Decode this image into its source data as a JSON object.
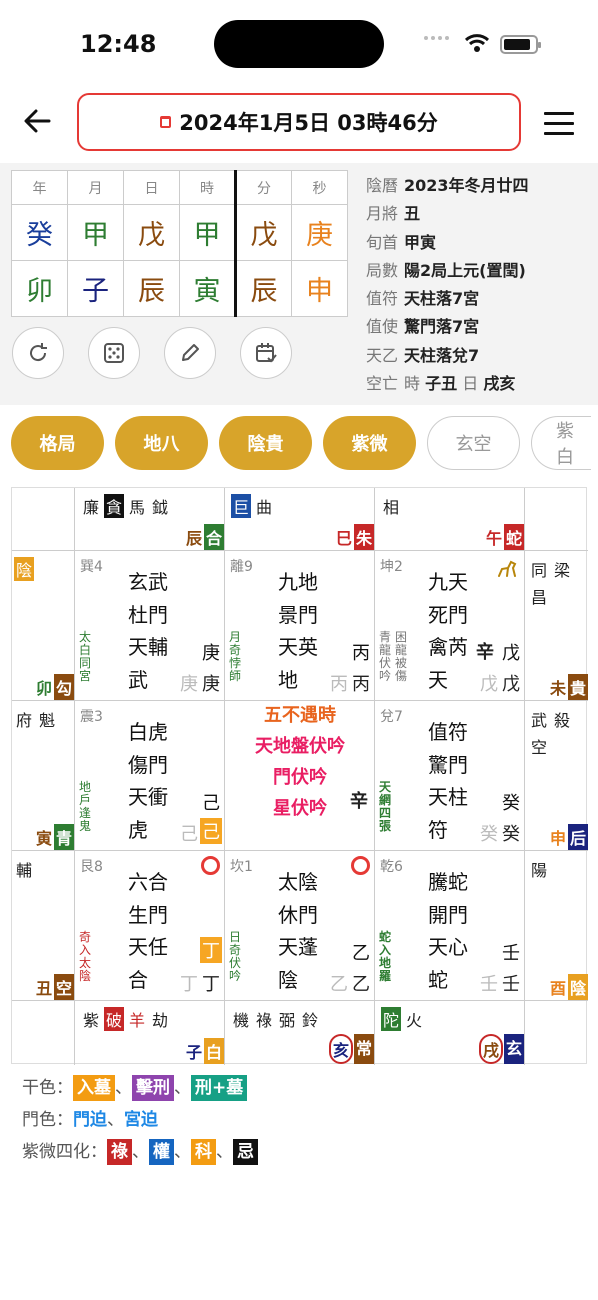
{
  "status": {
    "time": "12:48"
  },
  "header": {
    "date": "2024年1月5日 03時46分"
  },
  "pillars": {
    "headers": [
      "年",
      "月",
      "日",
      "時",
      "分",
      "秒"
    ],
    "stems": [
      "癸",
      "甲",
      "戊",
      "甲",
      "戊",
      "庚"
    ],
    "branches": [
      "卯",
      "子",
      "辰",
      "寅",
      "辰",
      "申"
    ]
  },
  "info": [
    {
      "label": "陰曆",
      "value": "2023年冬月廿四"
    },
    {
      "label": "月將",
      "value": "丑"
    },
    {
      "label": "旬首",
      "value": "甲寅"
    },
    {
      "label": "局數",
      "value": "陽2局上元(置閏)"
    },
    {
      "label": "值符",
      "value": "天柱落7宮"
    },
    {
      "label": "值使",
      "value": "驚門落7宮"
    },
    {
      "label": "天乙",
      "value": "天柱落兌7"
    }
  ],
  "kongwang": {
    "label": "空亡",
    "a": "時",
    "a1": "子",
    "a2": "丑",
    "b": "日",
    "b1": "戌",
    "b2": "亥"
  },
  "tabs": [
    "格局",
    "地八",
    "陰貴",
    "紫微",
    "玄空",
    "紫白"
  ],
  "outer": {
    "top": [
      {
        "stars": [
          "廉",
          "貪",
          "馬",
          "鉞"
        ],
        "branch": [
          "辰",
          "合"
        ]
      },
      {
        "stars": [
          "巨",
          "曲"
        ],
        "branch": [
          "巳",
          "朱"
        ]
      },
      {
        "stars": [
          "相"
        ],
        "branch": [
          "午",
          "蛇"
        ]
      }
    ],
    "left": [
      {
        "star": "陰",
        "branch": [
          "卯",
          "勾"
        ]
      },
      {
        "stars": [
          "府",
          "魁"
        ],
        "branch": [
          "寅",
          "青"
        ]
      },
      {
        "stars": [
          "輔"
        ],
        "branch": [
          "丑",
          "空"
        ]
      }
    ],
    "right": [
      {
        "stars": [
          "同",
          "梁",
          "昌"
        ],
        "branch": [
          "未",
          "貴"
        ]
      },
      {
        "stars": [
          "武",
          "殺",
          "空"
        ],
        "branch": [
          "申",
          "后"
        ]
      },
      {
        "stars": [
          "陽"
        ],
        "branch": [
          "酉",
          "陰"
        ]
      }
    ],
    "bottom": [
      {
        "stars": [
          "紫",
          "破",
          "羊",
          "劫"
        ],
        "branch": [
          "子",
          "白"
        ]
      },
      {
        "stars": [
          "機",
          "祿",
          "弼",
          "鈴"
        ],
        "branch": [
          "亥",
          "常"
        ]
      },
      {
        "stars": [
          "陀",
          "火"
        ],
        "branch": [
          "戌",
          "玄"
        ]
      }
    ]
  },
  "palaces": [
    {
      "gn": "巽4",
      "lines": [
        "玄武",
        "杜門",
        "天輔",
        "武"
      ],
      "vert": "太白同宮",
      "r1": "庚",
      "r2a": "庚",
      "r2b": "庚"
    },
    {
      "gn": "離9",
      "lines": [
        "九地",
        "景門",
        "天英",
        "地"
      ],
      "vert": "月奇悖師",
      "r1": "丙",
      "r2a": "丙",
      "r2b": "丙"
    },
    {
      "gn": "坤2",
      "lines": [
        "九天",
        "死門",
        "禽芮",
        "天"
      ],
      "vert": "青龍伏吟",
      "vert2": "困龍被傷",
      "r1": "戊",
      "mid": "辛",
      "r2a": "戊",
      "r2b": "戊"
    },
    {
      "gn": "震3",
      "lines": [
        "白虎",
        "傷門",
        "天衝",
        "虎"
      ],
      "vert": "地戶逢鬼",
      "r1": "己",
      "r2a": "己",
      "r2b": "己"
    },
    {
      "gn": "兌7",
      "lines": [
        "值符",
        "驚門",
        "天柱",
        "符"
      ],
      "vert": "天網四張",
      "r1": "癸",
      "r2a": "癸",
      "r2b": "癸"
    },
    {
      "gn": "艮8",
      "lines": [
        "六合",
        "生門",
        "天任",
        "合"
      ],
      "vert": "奇入太陰",
      "r1": "丁",
      "r2a": "丁",
      "r2b": "丁"
    },
    {
      "gn": "坎1",
      "lines": [
        "太陰",
        "休門",
        "天蓬",
        "陰"
      ],
      "vert": "日奇伏吟",
      "r1": "乙",
      "r2a": "乙",
      "r2b": "乙"
    },
    {
      "gn": "乾6",
      "lines": [
        "騰蛇",
        "開門",
        "天心",
        "蛇"
      ],
      "vert": "蛇入地羅",
      "r1": "壬",
      "r2a": "壬",
      "r2b": "壬"
    }
  ],
  "center": {
    "l1": "五不遇時",
    "l2": "天地盤伏吟",
    "l3": "門伏吟",
    "l4": "星伏吟",
    "stem": "辛"
  },
  "legend": {
    "gan_label": "干色：",
    "gan": [
      "入墓",
      "擊刑",
      "刑+墓"
    ],
    "men_label": "門色：",
    "men": [
      "門迫",
      "宮迫"
    ],
    "ziwei_label": "紫微四化：",
    "ziwei": [
      "祿",
      "權",
      "科",
      "忌"
    ],
    "sep": "、",
    "colors": {
      "ru_mu": "#f39c12",
      "ji_xing": "#8e44ad",
      "xing_mu": "#16a085",
      "lu": "#c62828",
      "quan": "#1565c0",
      "ke": "#f39c12",
      "ji": "#111111"
    }
  }
}
